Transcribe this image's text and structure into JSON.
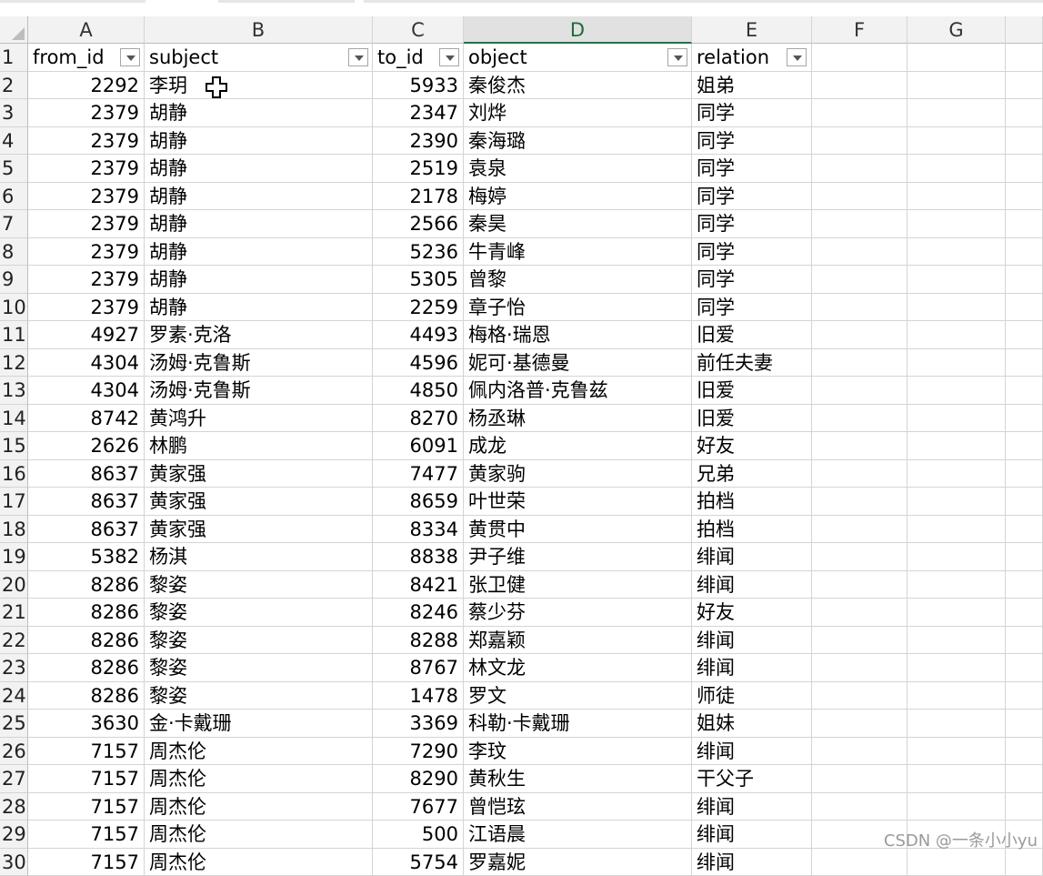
{
  "columns": [
    "A",
    "B",
    "C",
    "D",
    "E",
    "F",
    "G"
  ],
  "headers": [
    "from_id",
    "subject",
    "to_id",
    "object",
    "relation"
  ],
  "rows": [
    {
      "n": "1"
    },
    {
      "n": "2",
      "a": "2292",
      "b": "李玥",
      "c": "5933",
      "d": "秦俊杰",
      "e": "姐弟"
    },
    {
      "n": "3",
      "a": "2379",
      "b": "胡静",
      "c": "2347",
      "d": "刘烨",
      "e": "同学"
    },
    {
      "n": "4",
      "a": "2379",
      "b": "胡静",
      "c": "2390",
      "d": "秦海璐",
      "e": "同学"
    },
    {
      "n": "5",
      "a": "2379",
      "b": "胡静",
      "c": "2519",
      "d": "袁泉",
      "e": "同学"
    },
    {
      "n": "6",
      "a": "2379",
      "b": "胡静",
      "c": "2178",
      "d": "梅婷",
      "e": "同学"
    },
    {
      "n": "7",
      "a": "2379",
      "b": "胡静",
      "c": "2566",
      "d": "秦昊",
      "e": "同学"
    },
    {
      "n": "8",
      "a": "2379",
      "b": "胡静",
      "c": "5236",
      "d": "牛青峰",
      "e": "同学"
    },
    {
      "n": "9",
      "a": "2379",
      "b": "胡静",
      "c": "5305",
      "d": "曾黎",
      "e": "同学"
    },
    {
      "n": "10",
      "a": "2379",
      "b": "胡静",
      "c": "2259",
      "d": "章子怡",
      "e": "同学"
    },
    {
      "n": "11",
      "a": "4927",
      "b": "罗素·克洛",
      "c": "4493",
      "d": "梅格·瑞恩",
      "e": "旧爱"
    },
    {
      "n": "12",
      "a": "4304",
      "b": "汤姆·克鲁斯",
      "c": "4596",
      "d": "妮可·基德曼",
      "e": "前任夫妻"
    },
    {
      "n": "13",
      "a": "4304",
      "b": "汤姆·克鲁斯",
      "c": "4850",
      "d": "佩内洛普·克鲁兹",
      "e": "旧爱"
    },
    {
      "n": "14",
      "a": "8742",
      "b": "黄鸿升",
      "c": "8270",
      "d": "杨丞琳",
      "e": "旧爱"
    },
    {
      "n": "15",
      "a": "2626",
      "b": "林鹏",
      "c": "6091",
      "d": "成龙",
      "e": "好友"
    },
    {
      "n": "16",
      "a": "8637",
      "b": "黄家强",
      "c": "7477",
      "d": "黄家驹",
      "e": "兄弟"
    },
    {
      "n": "17",
      "a": "8637",
      "b": "黄家强",
      "c": "8659",
      "d": "叶世荣",
      "e": "拍档"
    },
    {
      "n": "18",
      "a": "8637",
      "b": "黄家强",
      "c": "8334",
      "d": "黄贯中",
      "e": "拍档"
    },
    {
      "n": "19",
      "a": "5382",
      "b": "杨淇",
      "c": "8838",
      "d": "尹子维",
      "e": "绯闻"
    },
    {
      "n": "20",
      "a": "8286",
      "b": "黎姿",
      "c": "8421",
      "d": "张卫健",
      "e": "绯闻"
    },
    {
      "n": "21",
      "a": "8286",
      "b": "黎姿",
      "c": "8246",
      "d": "蔡少芬",
      "e": "好友"
    },
    {
      "n": "22",
      "a": "8286",
      "b": "黎姿",
      "c": "8288",
      "d": "郑嘉颖",
      "e": "绯闻"
    },
    {
      "n": "23",
      "a": "8286",
      "b": "黎姿",
      "c": "8767",
      "d": "林文龙",
      "e": "绯闻"
    },
    {
      "n": "24",
      "a": "8286",
      "b": "黎姿",
      "c": "1478",
      "d": "罗文",
      "e": "师徒"
    },
    {
      "n": "25",
      "a": "3630",
      "b": "金·卡戴珊",
      "c": "3369",
      "d": "科勒·卡戴珊",
      "e": "姐妹"
    },
    {
      "n": "26",
      "a": "7157",
      "b": "周杰伦",
      "c": "7290",
      "d": "李玟",
      "e": "绯闻"
    },
    {
      "n": "27",
      "a": "7157",
      "b": "周杰伦",
      "c": "8290",
      "d": "黄秋生",
      "e": "干父子"
    },
    {
      "n": "28",
      "a": "7157",
      "b": "周杰伦",
      "c": "7677",
      "d": "曾恺玹",
      "e": "绯闻"
    },
    {
      "n": "29",
      "a": "7157",
      "b": "周杰伦",
      "c": "500",
      "d": "江语晨",
      "e": "绯闻"
    },
    {
      "n": "30",
      "a": "7157",
      "b": "周杰伦",
      "c": "5754",
      "d": "罗嘉妮",
      "e": "绯闻"
    }
  ],
  "watermark": "CSDN @一条小小yu"
}
